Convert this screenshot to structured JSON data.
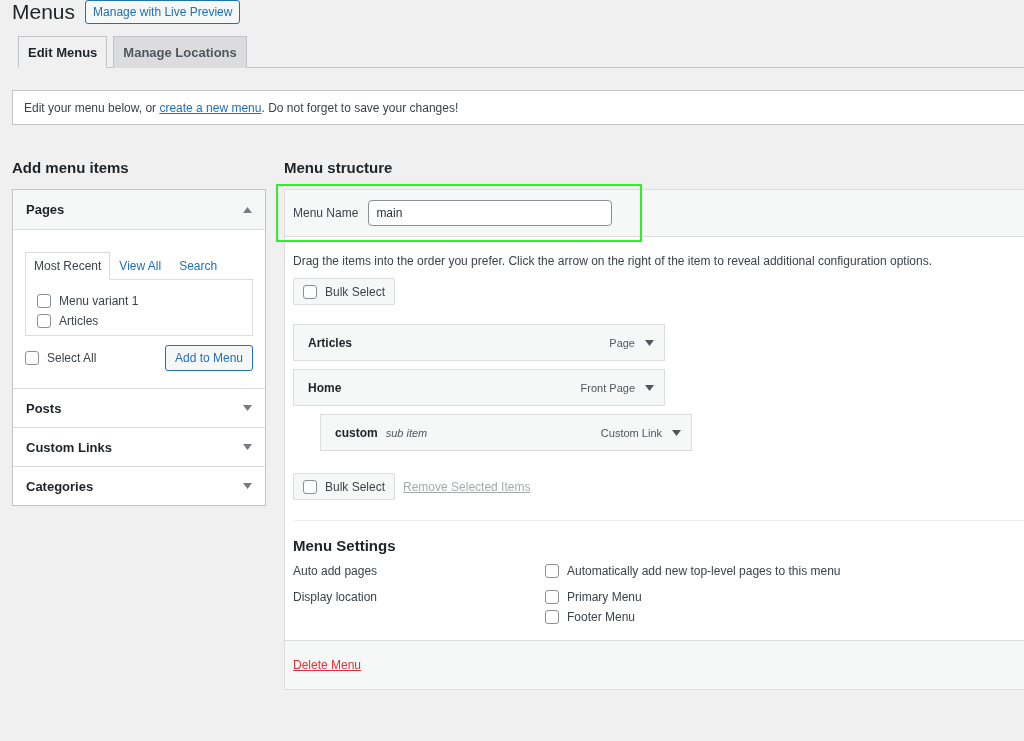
{
  "page_title": "Menus",
  "live_preview_button": "Manage with Live Preview",
  "tabs": [
    {
      "label": "Edit Menus",
      "selected": true
    },
    {
      "label": "Manage Locations",
      "selected": false
    }
  ],
  "notice": {
    "before": "Edit your menu below, or ",
    "link": "create a new menu",
    "after": ". Do not forget to save your changes!"
  },
  "add_items": {
    "heading": "Add menu items",
    "sections": [
      {
        "title": "Pages",
        "expanded": true,
        "tabs": [
          {
            "label": "Most Recent",
            "selected": true
          },
          {
            "label": "View All",
            "selected": false
          },
          {
            "label": "Search",
            "selected": false
          }
        ],
        "items": [
          {
            "label": "Menu variant 1",
            "checked": false
          },
          {
            "label": "Articles",
            "checked": false
          }
        ],
        "select_all": {
          "label": "Select All",
          "checked": false
        },
        "add_button": "Add to Menu"
      },
      {
        "title": "Posts",
        "expanded": false
      },
      {
        "title": "Custom Links",
        "expanded": false
      },
      {
        "title": "Categories",
        "expanded": false
      }
    ]
  },
  "structure": {
    "heading": "Menu structure",
    "menu_name_label": "Menu Name",
    "menu_name_value": "main",
    "instructions": "Drag the items into the order you prefer. Click the arrow on the right of the item to reveal additional configuration options.",
    "bulk_select_top": {
      "label": "Bulk Select",
      "checked": false
    },
    "items": [
      {
        "title": "Articles",
        "type": "Page"
      },
      {
        "title": "Home",
        "type": "Front Page",
        "children": [
          {
            "title": "custom",
            "note": "sub item",
            "type": "Custom Link"
          }
        ]
      }
    ],
    "bulk_select_bottom": {
      "label": "Bulk Select",
      "checked": false
    },
    "remove_link": "Remove Selected Items",
    "settings": {
      "heading": "Menu Settings",
      "rows": [
        {
          "label": "Auto add pages",
          "options": [
            {
              "label": "Automatically add new top-level pages to this menu",
              "checked": false
            }
          ]
        },
        {
          "label": "Display location",
          "options": [
            {
              "label": "Primary Menu",
              "checked": false
            },
            {
              "label": "Footer Menu",
              "checked": false
            }
          ]
        }
      ]
    },
    "delete_link": "Delete Menu"
  }
}
